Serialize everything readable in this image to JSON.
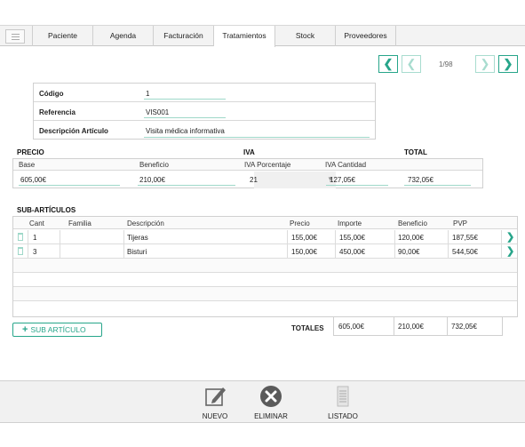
{
  "tabs": [
    {
      "label": "Paciente"
    },
    {
      "label": "Agenda"
    },
    {
      "label": "Facturación"
    },
    {
      "label": "Tratamientos"
    },
    {
      "label": "Stock"
    },
    {
      "label": "Proveedores"
    }
  ],
  "active_tab": "Tratamientos",
  "pagination": {
    "text": "1/98"
  },
  "article": {
    "codigo_label": "Código",
    "codigo_value": "1",
    "referencia_label": "Referencia",
    "referencia_value": "VIS001",
    "descripcion_label": "Descripción Artículo",
    "descripcion_value": "Visita médica informativa"
  },
  "precio": {
    "title": "PRECIO",
    "base_label": "Base",
    "base_value": "605,00€",
    "beneficio_label": "Beneficio",
    "beneficio_value": "210,00€"
  },
  "iva": {
    "title": "IVA",
    "porcentaje_label": "IVA Porcentaje",
    "porcentaje_value": "21",
    "cantidad_label": "IVA Cantidad",
    "cantidad_value": "127,05€"
  },
  "total": {
    "title": "TOTAL",
    "value": "732,05€"
  },
  "sub_articulos": {
    "title": "SUB-ARTÍCULOS",
    "headers": [
      "Cant",
      "Familia",
      "Descripción",
      "Precio",
      "Importe",
      "Beneficio",
      "PVP"
    ],
    "rows": [
      {
        "cant": "1",
        "familia": "",
        "descripcion": "Tijeras",
        "precio": "155,00€",
        "importe": "155,00€",
        "beneficio": "120,00€",
        "pvp": "187,55€"
      },
      {
        "cant": "3",
        "familia": "",
        "descripcion": "Bisturi",
        "precio": "150,00€",
        "importe": "450,00€",
        "beneficio": "90,00€",
        "pvp": "544,50€"
      }
    ],
    "add_label": "SUB ARTÍCULO"
  },
  "totales": {
    "label": "TOTALES",
    "importe": "605,00€",
    "beneficio": "210,00€",
    "pvp": "732,05€"
  },
  "toolbar": {
    "nuevo_label": "NUEVO",
    "eliminar_label": "ELIMINAR",
    "listado_label": "LISTADO"
  },
  "colors": {
    "accent": "#27a58a",
    "accent_light": "#9fd8c9"
  },
  "icons": {
    "menu": "menu-icon",
    "prev": "chevron-left-icon",
    "next": "chevron-right-icon",
    "delete_row": "trash-icon",
    "row_open": "chevron-right-icon",
    "add": "plus-icon",
    "nuevo": "edit-icon",
    "eliminar": "delete-circle-icon",
    "listado": "list-icon"
  }
}
